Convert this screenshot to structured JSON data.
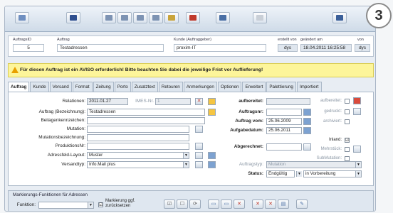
{
  "badge": "3",
  "toolbar": {
    "icons": [
      "window-icon",
      "save-icon",
      "first-icon",
      "prev-icon",
      "next-icon",
      "last-icon",
      "export-icon",
      "delete-icon",
      "binoculars-icon",
      "tool-icon",
      "info-icon",
      "help-icon"
    ]
  },
  "info": {
    "auftrag_id_label": "AuftragsID",
    "auftrag_id": "5",
    "auftrag_label": "Auftrag",
    "auftrag": "Testadressen",
    "kunde_label": "Kunde (Auftraggeber)",
    "kunde": "proxim-IT",
    "erstellt_label": "erstellt von",
    "erstellt": "dys",
    "geaendert_label": "geändert am",
    "geaendert": "18.04.2011 16:25:58",
    "von_label": "von",
    "von": "dys"
  },
  "warning": "Für diesen Auftrag ist ein AVISO erforderlich! Bitte beachten Sie dabei die jeweilige Frist vor Auflieferung!",
  "tabs": [
    "Auftrag",
    "Kunde",
    "Versand",
    "Format",
    "Zeitung",
    "Porto",
    "Zusatztext",
    "Retouren",
    "Anmerkungen",
    "Optionen",
    "Erweitert",
    "Palettierung",
    "Importiert"
  ],
  "form": {
    "relationen_label": "Relationen:",
    "relationen": "2011.01.27",
    "imes_label": "IMES-Nr.",
    "imes": "1",
    "auftrag_bez_label": "Auftrag (Bezeichnung):",
    "auftrag_bez": "Testadressen",
    "beilagen_label": "Beilagenkennzeichen:",
    "beilagen": "",
    "mutation_label": "Mutation:",
    "mutation": "",
    "mutbez_label": "Mutationsbezeichnung:",
    "mutbez": "",
    "produktion_label": "ProduktionsNr:",
    "produktion": "",
    "layout_label": "Adressfeld-Layout:",
    "layout": "Muster",
    "versand_label": "Versandtyp:",
    "versand": "Info.Mail plus",
    "aufbereitet_label": "aufbereitet:",
    "auftragsnr_label": "Auftragsnr:",
    "auftragvom_label": "Auftrag vom:",
    "auftragvom": "25.06.2009",
    "aufgabe_label": "Aufgabedatum:",
    "aufgabe": "25.06.2011",
    "abgerechnet_label": "Abgerechnet:",
    "auftragstyp_label": "Auftragstyp:",
    "auftragstyp": "Mutation",
    "status_label": "Status:",
    "status": "Endgültig",
    "status2": "in Vorbereitung",
    "r_aufbereitet": "aufbereitet:",
    "r_gedruckt": "gedruckt:",
    "r_archiviert": "archiviert:",
    "r_inland": "Inland:",
    "r_mehrstueck": "Mehrstück:",
    "r_submutation": "SubMutation:",
    "inland_checked": "☑"
  },
  "bottom": {
    "header": "Markierungs-Funktionen für Adressen",
    "funktion_label": "Funktion:",
    "markierung_label_1": "Markierung ggf.",
    "markierung_label_2": "zurücksetzen"
  }
}
